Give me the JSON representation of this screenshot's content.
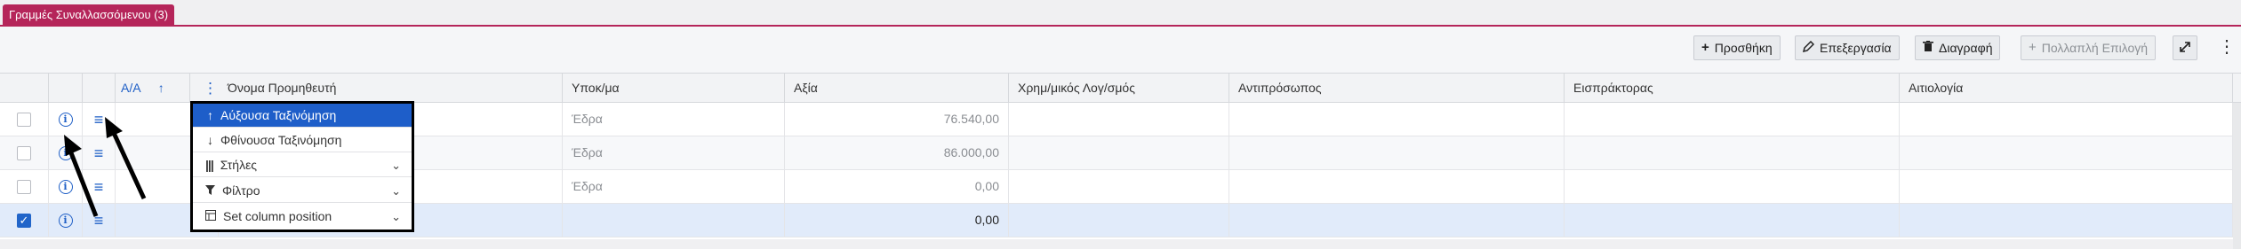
{
  "tab": {
    "label": "Γραμμές Συναλλασσόμενου (3)"
  },
  "toolbar": {
    "add": "Προσθήκη",
    "edit": "Επεξεργασία",
    "delete": "Διαγραφή",
    "multi": "Πολλαπλή Επιλογή"
  },
  "columns": {
    "aa": "Α/Α",
    "supplier": "Όνομα Προμηθευτή",
    "branch": "Υποκ/μα",
    "value": "Αξία",
    "account": "Χρημ/μικός Λογ/σμός",
    "representative": "Αντιπρόσωπος",
    "collector": "Εισπράκτορας",
    "reason": "Αιτιολογία"
  },
  "rows": [
    {
      "branch": "Έδρα",
      "value": "76.540,00",
      "selected": false
    },
    {
      "branch": "Έδρα",
      "value": "86.000,00",
      "selected": false
    },
    {
      "branch": "Έδρα",
      "value": "0,00",
      "selected": false
    },
    {
      "branch": "",
      "value": "0,00",
      "selected": true
    }
  ],
  "menu": {
    "sort_asc": "Αύξουσα Ταξινόμηση",
    "sort_desc": "Φθίνουσα Ταξινόμηση",
    "columns": "Στήλες",
    "filter": "Φίλτρο",
    "set_position": "Set column position"
  },
  "colors": {
    "brand": "#b5255a",
    "accent": "#1e5ec9"
  }
}
